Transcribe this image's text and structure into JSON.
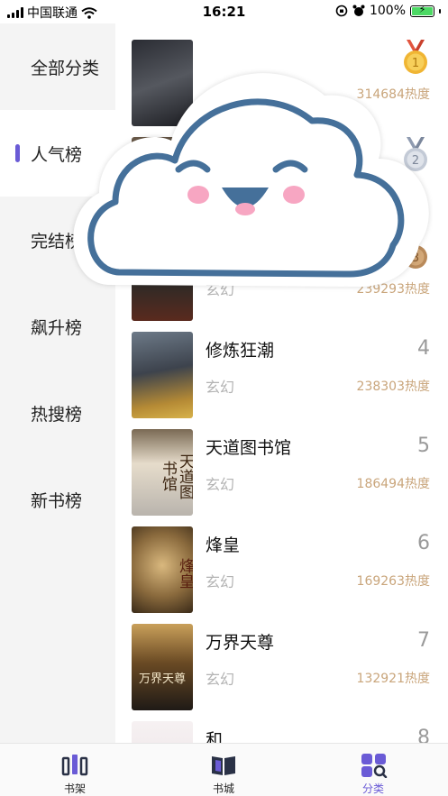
{
  "status_bar": {
    "carrier": "中国联通",
    "time": "16:21",
    "battery": "100%",
    "battery_level": 1.0
  },
  "sidebar": {
    "items": [
      {
        "label": "全部分类",
        "active": false
      },
      {
        "label": "人气榜",
        "active": true
      },
      {
        "label": "完结榜",
        "active": false
      },
      {
        "label": "飙升榜",
        "active": false
      },
      {
        "label": "热搜榜",
        "active": false
      },
      {
        "label": "新书榜",
        "active": false
      }
    ]
  },
  "books": [
    {
      "rank": "1",
      "title": "",
      "genre": "",
      "heat": "314684热度",
      "medal": "gold"
    },
    {
      "rank": "2",
      "title": "",
      "genre": "",
      "heat": "",
      "medal": "silver"
    },
    {
      "rank": "3",
      "title": "",
      "genre": "玄幻",
      "heat": "239293热度",
      "medal": "bronze"
    },
    {
      "rank": "4",
      "title": "修炼狂潮",
      "genre": "玄幻",
      "heat": "238303热度",
      "medal": ""
    },
    {
      "rank": "5",
      "title": "天道图书馆",
      "genre": "玄幻",
      "heat": "186494热度",
      "medal": ""
    },
    {
      "rank": "6",
      "title": "烽皇",
      "genre": "玄幻",
      "heat": "169263热度",
      "medal": ""
    },
    {
      "rank": "7",
      "title": "万界天尊",
      "genre": "玄幻",
      "heat": "132921热度",
      "medal": ""
    },
    {
      "rank": "8",
      "title": "和",
      "genre": "",
      "heat": "",
      "medal": ""
    }
  ],
  "covers": [
    {
      "text": "",
      "bg": "#3a3d44"
    },
    {
      "text": "",
      "bg": "#6b5b4a"
    },
    {
      "text": "",
      "bg": "#2c2a27"
    },
    {
      "text": "",
      "bg": "#4a4c55"
    },
    {
      "text": "天道图书馆",
      "bg": "#d9cdb8"
    },
    {
      "text": "烽皇",
      "bg": "#7a5a33"
    },
    {
      "text": "万界天尊",
      "bg": "#4b3a22"
    },
    {
      "text": "",
      "bg": "#f3eef0"
    }
  ],
  "tabbar": {
    "items": [
      {
        "label": "书架",
        "icon": "bookshelf-icon",
        "active": false
      },
      {
        "label": "书城",
        "icon": "book-open-icon",
        "active": false
      },
      {
        "label": "分类",
        "icon": "category-grid-icon",
        "active": true
      }
    ]
  },
  "overlay": {
    "icon": "smiling-cloud-icon"
  },
  "colors": {
    "accent": "#6a5bd6",
    "heat": "#c9a57b",
    "cloud_outline": "#45709a",
    "cheek": "#f7a6c2",
    "sidebar_bg": "#f4f4f4"
  }
}
